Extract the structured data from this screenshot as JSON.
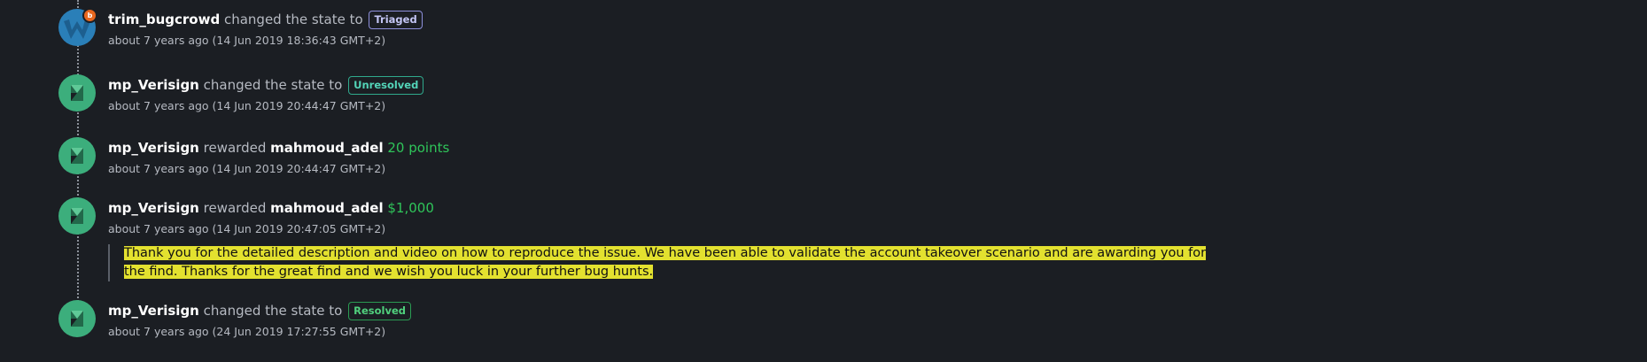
{
  "entries": [
    {
      "actor": "trim_bugcrowd",
      "verb": "changed the state to",
      "state": "Triaged",
      "time": "about 7 years ago (14 Jun 2019 18:36:43 GMT+2)",
      "avatar_badge": "b"
    },
    {
      "actor": "mp_Verisign",
      "verb": "changed the state to",
      "state": "Unresolved",
      "time": "about 7 years ago (14 Jun 2019 20:44:47 GMT+2)"
    },
    {
      "actor": "mp_Verisign",
      "verb": "rewarded",
      "target": "mahmoud_adel",
      "reward": "20 points",
      "time": "about 7 years ago (14 Jun 2019 20:44:47 GMT+2)"
    },
    {
      "actor": "mp_Verisign",
      "verb": "rewarded",
      "target": "mahmoud_adel",
      "reward": "$1,000",
      "time": "about 7 years ago (14 Jun 2019 20:47:05 GMT+2)"
    },
    {
      "actor": "mp_Verisign",
      "verb": "changed the state to",
      "state": "Resolved",
      "time": "about 7 years ago (24 Jun 2019 17:27:55 GMT+2)"
    }
  ],
  "comment": {
    "text": "Thank you for the detailed description and video on how to reproduce the issue. We have been able to validate the account takeover scenario and are awarding you for the find. Thanks for the great find and we wish you luck in your further bug hunts."
  },
  "colors": {
    "background": "#1b1e23",
    "highlight": "#e3e12f",
    "reward_green": "#2fc55a",
    "bugcrowd_orange": "#e8671e"
  },
  "icons": {
    "bugcrowd_avatar": "bugcrowd-avatar-icon",
    "verisign_avatar": "verisign-avatar-icon"
  }
}
